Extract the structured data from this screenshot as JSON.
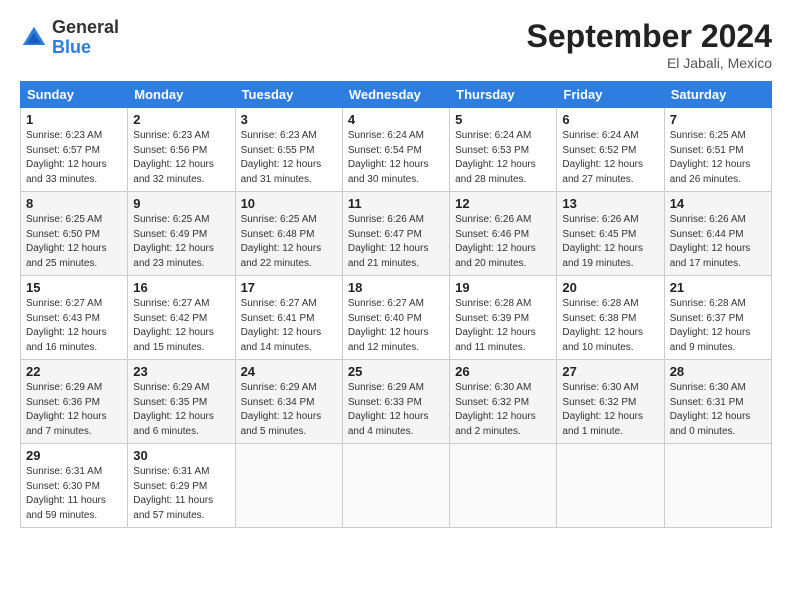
{
  "logo": {
    "general": "General",
    "blue": "Blue"
  },
  "header": {
    "month": "September 2024",
    "location": "El Jabali, Mexico"
  },
  "days_of_week": [
    "Sunday",
    "Monday",
    "Tuesday",
    "Wednesday",
    "Thursday",
    "Friday",
    "Saturday"
  ],
  "weeks": [
    [
      {
        "day": "1",
        "info": "Sunrise: 6:23 AM\nSunset: 6:57 PM\nDaylight: 12 hours\nand 33 minutes."
      },
      {
        "day": "2",
        "info": "Sunrise: 6:23 AM\nSunset: 6:56 PM\nDaylight: 12 hours\nand 32 minutes."
      },
      {
        "day": "3",
        "info": "Sunrise: 6:23 AM\nSunset: 6:55 PM\nDaylight: 12 hours\nand 31 minutes."
      },
      {
        "day": "4",
        "info": "Sunrise: 6:24 AM\nSunset: 6:54 PM\nDaylight: 12 hours\nand 30 minutes."
      },
      {
        "day": "5",
        "info": "Sunrise: 6:24 AM\nSunset: 6:53 PM\nDaylight: 12 hours\nand 28 minutes."
      },
      {
        "day": "6",
        "info": "Sunrise: 6:24 AM\nSunset: 6:52 PM\nDaylight: 12 hours\nand 27 minutes."
      },
      {
        "day": "7",
        "info": "Sunrise: 6:25 AM\nSunset: 6:51 PM\nDaylight: 12 hours\nand 26 minutes."
      }
    ],
    [
      {
        "day": "8",
        "info": "Sunrise: 6:25 AM\nSunset: 6:50 PM\nDaylight: 12 hours\nand 25 minutes."
      },
      {
        "day": "9",
        "info": "Sunrise: 6:25 AM\nSunset: 6:49 PM\nDaylight: 12 hours\nand 23 minutes."
      },
      {
        "day": "10",
        "info": "Sunrise: 6:25 AM\nSunset: 6:48 PM\nDaylight: 12 hours\nand 22 minutes."
      },
      {
        "day": "11",
        "info": "Sunrise: 6:26 AM\nSunset: 6:47 PM\nDaylight: 12 hours\nand 21 minutes."
      },
      {
        "day": "12",
        "info": "Sunrise: 6:26 AM\nSunset: 6:46 PM\nDaylight: 12 hours\nand 20 minutes."
      },
      {
        "day": "13",
        "info": "Sunrise: 6:26 AM\nSunset: 6:45 PM\nDaylight: 12 hours\nand 19 minutes."
      },
      {
        "day": "14",
        "info": "Sunrise: 6:26 AM\nSunset: 6:44 PM\nDaylight: 12 hours\nand 17 minutes."
      }
    ],
    [
      {
        "day": "15",
        "info": "Sunrise: 6:27 AM\nSunset: 6:43 PM\nDaylight: 12 hours\nand 16 minutes."
      },
      {
        "day": "16",
        "info": "Sunrise: 6:27 AM\nSunset: 6:42 PM\nDaylight: 12 hours\nand 15 minutes."
      },
      {
        "day": "17",
        "info": "Sunrise: 6:27 AM\nSunset: 6:41 PM\nDaylight: 12 hours\nand 14 minutes."
      },
      {
        "day": "18",
        "info": "Sunrise: 6:27 AM\nSunset: 6:40 PM\nDaylight: 12 hours\nand 12 minutes."
      },
      {
        "day": "19",
        "info": "Sunrise: 6:28 AM\nSunset: 6:39 PM\nDaylight: 12 hours\nand 11 minutes."
      },
      {
        "day": "20",
        "info": "Sunrise: 6:28 AM\nSunset: 6:38 PM\nDaylight: 12 hours\nand 10 minutes."
      },
      {
        "day": "21",
        "info": "Sunrise: 6:28 AM\nSunset: 6:37 PM\nDaylight: 12 hours\nand 9 minutes."
      }
    ],
    [
      {
        "day": "22",
        "info": "Sunrise: 6:29 AM\nSunset: 6:36 PM\nDaylight: 12 hours\nand 7 minutes."
      },
      {
        "day": "23",
        "info": "Sunrise: 6:29 AM\nSunset: 6:35 PM\nDaylight: 12 hours\nand 6 minutes."
      },
      {
        "day": "24",
        "info": "Sunrise: 6:29 AM\nSunset: 6:34 PM\nDaylight: 12 hours\nand 5 minutes."
      },
      {
        "day": "25",
        "info": "Sunrise: 6:29 AM\nSunset: 6:33 PM\nDaylight: 12 hours\nand 4 minutes."
      },
      {
        "day": "26",
        "info": "Sunrise: 6:30 AM\nSunset: 6:32 PM\nDaylight: 12 hours\nand 2 minutes."
      },
      {
        "day": "27",
        "info": "Sunrise: 6:30 AM\nSunset: 6:32 PM\nDaylight: 12 hours\nand 1 minute."
      },
      {
        "day": "28",
        "info": "Sunrise: 6:30 AM\nSunset: 6:31 PM\nDaylight: 12 hours\nand 0 minutes."
      }
    ],
    [
      {
        "day": "29",
        "info": "Sunrise: 6:31 AM\nSunset: 6:30 PM\nDaylight: 11 hours\nand 59 minutes."
      },
      {
        "day": "30",
        "info": "Sunrise: 6:31 AM\nSunset: 6:29 PM\nDaylight: 11 hours\nand 57 minutes."
      },
      {
        "day": "",
        "info": ""
      },
      {
        "day": "",
        "info": ""
      },
      {
        "day": "",
        "info": ""
      },
      {
        "day": "",
        "info": ""
      },
      {
        "day": "",
        "info": ""
      }
    ]
  ]
}
